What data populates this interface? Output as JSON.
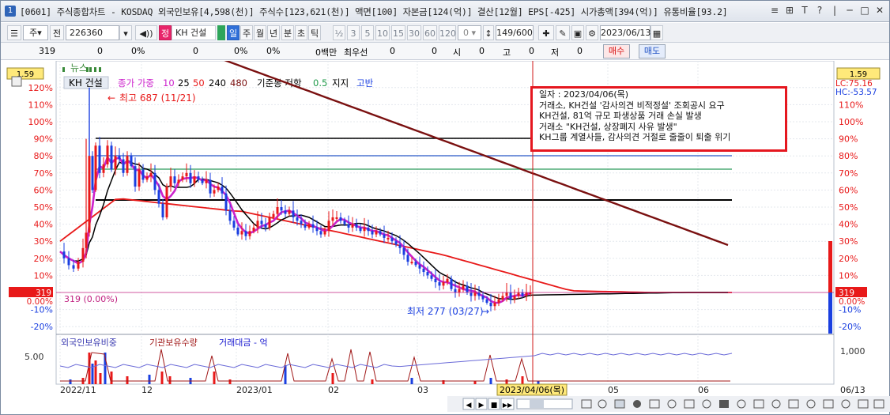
{
  "title_bar": {
    "window_number": "1",
    "title": "[0601] 주식종합차트 - KOSDAQ 외국인보유[4,598(천)] 주식수[123,621(천)] 액면[100] 자본금[124(억)] 결산[12월] EPS[-425] 시가총액[394(억)] 유통비율[93.2]",
    "controls": [
      "≡",
      "⊞",
      "T",
      "?",
      "|",
      "─",
      "□",
      "✕"
    ]
  },
  "toolbar": {
    "market_type": "주",
    "jeon": "전",
    "code": "226360",
    "stock_badge": "정",
    "stock_name": "KH 건설",
    "periods": [
      "일",
      "주",
      "월",
      "년",
      "분",
      "초",
      "틱"
    ],
    "active_period": "일",
    "intervals": [
      "½",
      "3",
      "5",
      "10",
      "15",
      "30",
      "60",
      "120"
    ],
    "interval_value": "0",
    "count": "149/600",
    "date": "2023/06/13"
  },
  "quote_bar": {
    "price": "319",
    "change": "0",
    "change_pct": "0%",
    "volume": "0",
    "vol_pct": "0%",
    "vol_pct2": "0%",
    "amount": "0백만",
    "preferred_label": "최우선",
    "pref1": "0",
    "pref2": "0",
    "open_label": "시",
    "open": "0",
    "high_label": "고",
    "high": "0",
    "low_label": "저",
    "low": "0",
    "buy_button": "매수",
    "sell_button": "매도"
  },
  "chart_panel": {
    "news_label": "뉴스",
    "left_badge": "1.59",
    "right_badge": "1.59",
    "lc_label": "LC:75.16",
    "hc_label": "HC:-53.57",
    "legend": {
      "stock": "KH 건설",
      "ma_label": "종가 가중",
      "ma_periods": [
        "10",
        "25",
        "50",
        "240",
        "480"
      ],
      "ma_colors": [
        "#cc22cc",
        "#000000",
        "#e81919",
        "#000000",
        "#7a1010"
      ],
      "base_label": "기준봉 저항",
      "base_value": "0.5",
      "support": "지지",
      "breakout": "고반"
    },
    "high_annotation": "최고 687 (11/21)",
    "low_annotation": "최저 277 (03/27)",
    "current_price_label": "319",
    "current_pct_label": "0.00%",
    "right_current_price": "319",
    "right_current_pct": "0.00%",
    "current_line_label": "319 (0.00%)",
    "crosshair_date": "2023/04/06(목)",
    "date_labels": [
      "2022/11",
      "12",
      "2023/01",
      "02",
      "03",
      "05",
      "06",
      "06/13"
    ],
    "pct_ticks": [
      "120%",
      "110%",
      "100%",
      "90%",
      "80%",
      "70%",
      "60%",
      "50%",
      "40%",
      "30%",
      "20%",
      "10%",
      "0.00%",
      "-10%",
      "-20%"
    ],
    "right_ticks": [
      "110%",
      "100%",
      "90%",
      "80%",
      "70%",
      "60%",
      "50%",
      "40%",
      "30%",
      "20%",
      "10%",
      "-10%",
      "-20%"
    ]
  },
  "info_box": {
    "lines": [
      "일자      : 2023/04/06(목)",
      "거래소, KH건설  '감사의견 비적정설'  조회공시 요구",
      "KH건설, 81억 규모 파생상품 거래 손실 발생",
      "거래소  \"KH건설, 상장폐지 사유 발생\"",
      "KH그룹 계열사들, 감사의견 거절로 줄줄이 퇴출 위기"
    ]
  },
  "volume_panel": {
    "legend": [
      "외국인보유비중",
      "기관보유수량",
      "거래대금 - 억"
    ],
    "legend_colors": [
      "#3a3ab0",
      "#a01818",
      "#1a1ad0"
    ],
    "left_tick": "5.00",
    "right_tick": "1,000"
  },
  "bottom_bar": {
    "nav_buttons": [
      "◀",
      "▶",
      "■",
      "▶▶"
    ]
  },
  "colors": {
    "up": "#e81919",
    "down": "#1a3fe0",
    "accent": "#2f6fd8",
    "highlight_box": "#e5171f"
  }
}
